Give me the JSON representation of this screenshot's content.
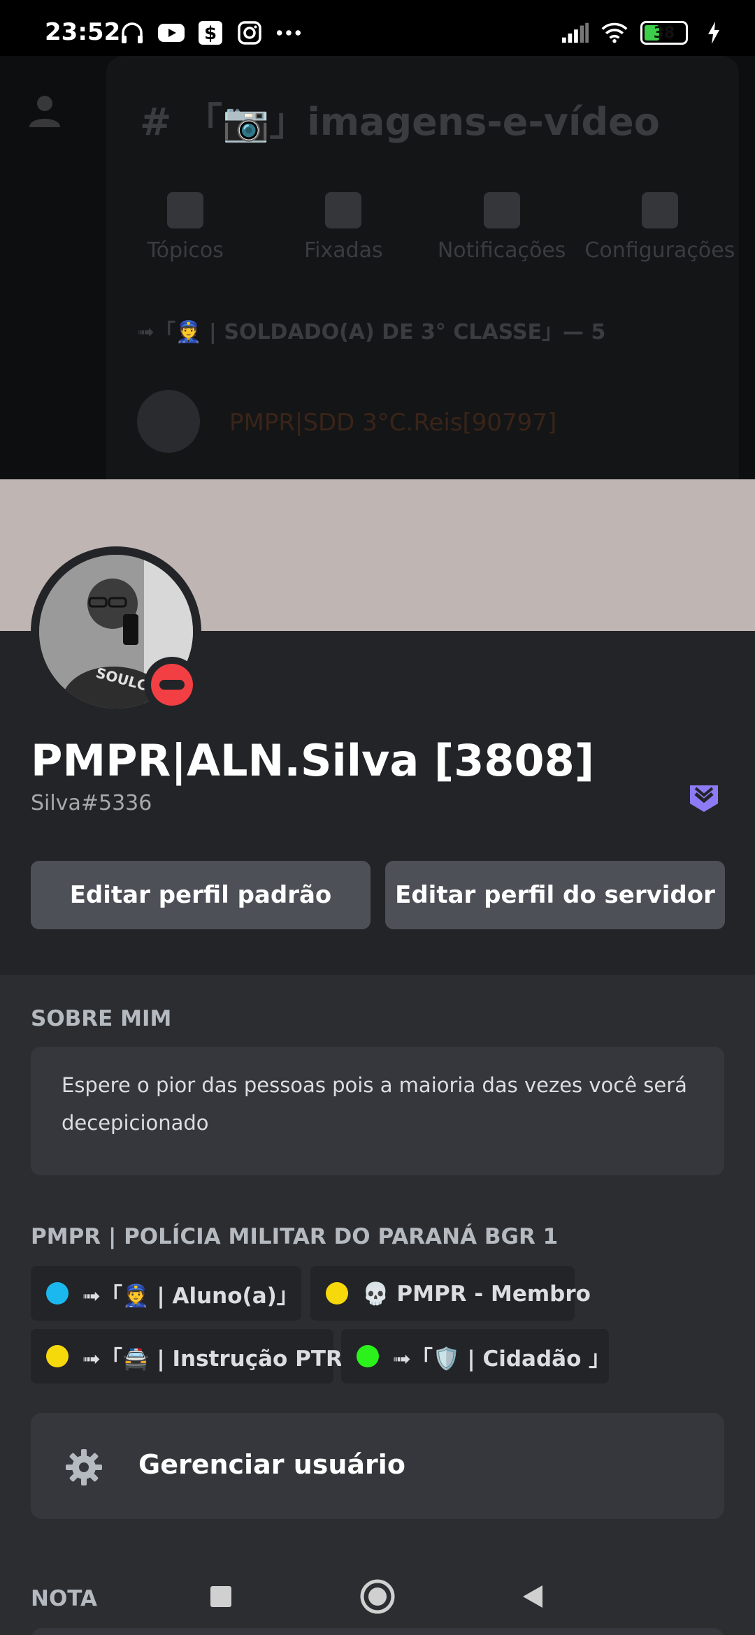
{
  "status_bar": {
    "time": "23:52",
    "battery": "38",
    "battery_level": 0.38,
    "icons_left": [
      "headphones-icon",
      "youtube-icon",
      "dollar-app-icon",
      "instagram-icon",
      "more-dots-icon"
    ],
    "icons_right": [
      "signal-icon",
      "wifi-icon",
      "battery-icon",
      "charging-icon"
    ]
  },
  "background_channel": {
    "channel_name": "「📷」imagens-e-vídeo",
    "tools": [
      {
        "label": "Tópicos",
        "icon": "threads-icon"
      },
      {
        "label": "Fixadas",
        "icon": "pin-icon"
      },
      {
        "label": "Notificações",
        "icon": "bell-icon"
      },
      {
        "label": "Configurações",
        "icon": "gear-icon"
      }
    ],
    "role_header": "➟「👮 | SOLDADO(A) DE 3° CLASSE」— 5",
    "member_name": "PMPR|SDD 3°C.Reis[90797]"
  },
  "profile": {
    "banner_color": "#bfb5b3",
    "display_name": "PMPR|ALN.Silva [3808]",
    "username": "Silva#5336",
    "status": "do-not-disturb",
    "status_color": "#f23f43",
    "buttons": {
      "edit_default": "Editar perfil padrão",
      "edit_server": "Editar perfil do servidor"
    }
  },
  "about": {
    "title": "SOBRE MIM",
    "text": "Espere o pior das pessoas pois a maioria das vezes você será decepicionado"
  },
  "roles": {
    "title": "PMPR | POLÍCIA MILITAR DO PARANÁ BGR 1",
    "items": [
      {
        "label": "➟「👮 | Aluno(a)」",
        "color": "#1bb8f0"
      },
      {
        "label": "💀 PMPR - Membro",
        "color": "#f5d90a"
      },
      {
        "label": "➟「🚔 |  Instrução PTR",
        "color": "#f5d90a"
      },
      {
        "label": "➟「🛡️ | Cidadão 」",
        "color": "#2bf21b"
      }
    ]
  },
  "manage": {
    "label": "Gerenciar usuário",
    "icon": "gear-icon"
  },
  "note": {
    "title": "NOTA"
  },
  "nav": {
    "buttons": [
      "recent-apps-icon",
      "home-icon",
      "back-icon"
    ]
  }
}
